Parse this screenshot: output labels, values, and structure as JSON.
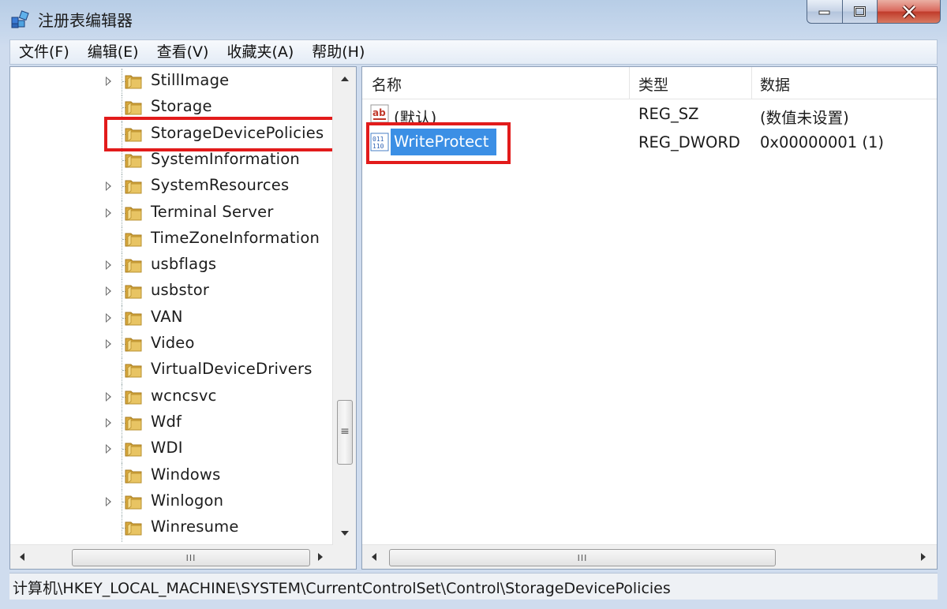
{
  "window": {
    "title": "注册表编辑器"
  },
  "menu": [
    {
      "label": "文件(F)"
    },
    {
      "label": "编辑(E)"
    },
    {
      "label": "查看(V)"
    },
    {
      "label": "收藏夹(A)"
    },
    {
      "label": "帮助(H)"
    }
  ],
  "tree": {
    "items": [
      {
        "label": "StillImage",
        "expandable": true
      },
      {
        "label": "Storage",
        "expandable": false
      },
      {
        "label": "StorageDevicePolicies",
        "expandable": false,
        "highlighted": true
      },
      {
        "label": "SystemInformation",
        "expandable": false
      },
      {
        "label": "SystemResources",
        "expandable": true
      },
      {
        "label": "Terminal Server",
        "expandable": true
      },
      {
        "label": "TimeZoneInformation",
        "expandable": false
      },
      {
        "label": "usbflags",
        "expandable": true
      },
      {
        "label": "usbstor",
        "expandable": true
      },
      {
        "label": "VAN",
        "expandable": true
      },
      {
        "label": "Video",
        "expandable": true
      },
      {
        "label": "VirtualDeviceDrivers",
        "expandable": false
      },
      {
        "label": "wcncsvc",
        "expandable": true
      },
      {
        "label": "Wdf",
        "expandable": true
      },
      {
        "label": "WDI",
        "expandable": true
      },
      {
        "label": "Windows",
        "expandable": false
      },
      {
        "label": "Winlogon",
        "expandable": true
      },
      {
        "label": "Winresume",
        "expandable": false
      }
    ]
  },
  "values": {
    "columns": [
      "名称",
      "类型",
      "数据"
    ],
    "rows": [
      {
        "name": "(默认)",
        "type": "REG_SZ",
        "data": "(数值未设置)",
        "icon": "string-value-icon",
        "selected": false
      },
      {
        "name": "WriteProtect",
        "type": "REG_DWORD",
        "data": "0x00000001 (1)",
        "icon": "dword-value-icon",
        "selected": true
      }
    ]
  },
  "scroll": {
    "thumb_glyph": "III",
    "vthumb_glyph": "≡"
  },
  "status": {
    "path": "计算机\\HKEY_LOCAL_MACHINE\\SYSTEM\\CurrentControlSet\\Control\\StorageDevicePolicies"
  },
  "colors": {
    "highlight": "#e21b1b",
    "selection": "#3b8fe5",
    "folder": "#e8c463"
  }
}
